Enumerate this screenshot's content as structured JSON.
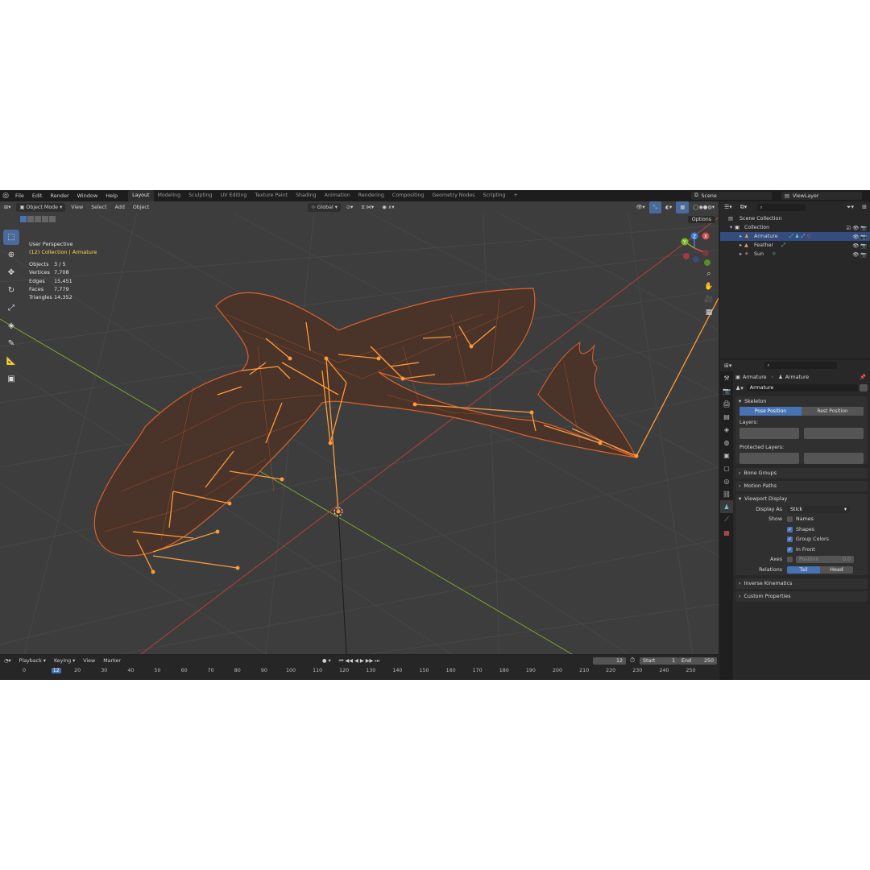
{
  "menus": [
    "File",
    "Edit",
    "Render",
    "Window",
    "Help"
  ],
  "workspaces": [
    "Layout",
    "Modeling",
    "Sculpting",
    "UV Editing",
    "Texture Paint",
    "Shading",
    "Animation",
    "Rendering",
    "Compositing",
    "Geometry Nodes",
    "Scripting"
  ],
  "workspace_add": "+",
  "scene_name": "Scene",
  "view_layer": "ViewLayer",
  "viewport": {
    "mode": "Object Mode",
    "menus": [
      "View",
      "Select",
      "Add",
      "Object"
    ],
    "transform_orientation": "Global",
    "options_label": "Options",
    "perspective": "User Perspective",
    "collection_info": "(12) Collection | Armature",
    "stats": [
      {
        "label": "Objects",
        "value": "3 / 5"
      },
      {
        "label": "Vertices",
        "value": "7,708"
      },
      {
        "label": "Edges",
        "value": "15,451"
      },
      {
        "label": "Faces",
        "value": "7,779"
      },
      {
        "label": "Triangles",
        "value": "14,352"
      }
    ],
    "gizmo_axes": [
      "Z",
      "Y",
      "X"
    ]
  },
  "timeline": {
    "menus": [
      "Playback",
      "Keying",
      "View",
      "Marker"
    ],
    "current_frame": "12",
    "start_label": "Start",
    "start": "1",
    "end_label": "End",
    "end": "250",
    "ruler": [
      "0",
      "12",
      "20",
      "30",
      "40",
      "50",
      "60",
      "70",
      "80",
      "90",
      "100",
      "110",
      "120",
      "130",
      "140",
      "150",
      "160",
      "170",
      "180",
      "190",
      "200",
      "210",
      "220",
      "230",
      "240",
      "250"
    ]
  },
  "outliner": {
    "items": [
      {
        "label": "Scene Collection",
        "selected": false
      },
      {
        "label": "Collection",
        "selected": false
      },
      {
        "label": "Armature",
        "selected": true
      },
      {
        "label": "Feather",
        "selected": false
      },
      {
        "label": "Sun",
        "selected": false
      }
    ]
  },
  "properties": {
    "breadcrumb": [
      "Armature",
      "Armature"
    ],
    "datablock": "Armature",
    "skeleton_label": "Skeleton",
    "pose_position": "Pose Position",
    "rest_position": "Rest Position",
    "layers_label": "Layers:",
    "protected_layers_label": "Protected Layers:",
    "bone_groups": "Bone Groups",
    "motion_paths": "Motion Paths",
    "viewport_display": "Viewport Display",
    "display_as_label": "Display As",
    "display_as_value": "Stick",
    "show_label": "Show",
    "names": "Names",
    "shapes": "Shapes",
    "group_colors": "Group Colors",
    "in_front": "In Front",
    "axes_label": "Axes",
    "position_label": "Position",
    "position_value": "0.0",
    "relations_label": "Relations",
    "tail": "Tail",
    "head": "Head",
    "inverse_kinematics": "Inverse Kinematics",
    "custom_properties": "Custom Properties"
  },
  "colors": {
    "accent": "#4772b3",
    "selection_orange": "#ff8c26",
    "wire_orange": "#d9622b",
    "x_axis": "#c0392b",
    "y_axis": "#8aba2c"
  }
}
